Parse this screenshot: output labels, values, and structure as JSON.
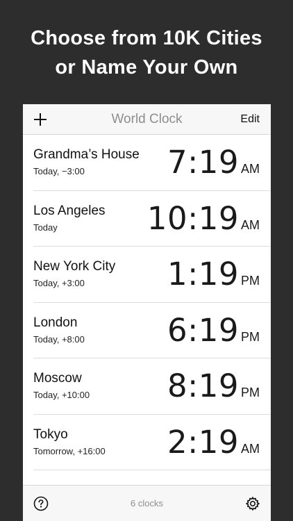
{
  "headline": {
    "line1": "Choose from 10K Cities",
    "line2": "or Name Your Own"
  },
  "navbar": {
    "title": "World Clock",
    "edit_label": "Edit",
    "add_icon": "plus-icon"
  },
  "clocks": [
    {
      "city": "Grandma’s House",
      "offset": "Today, −3:00",
      "time": "7:19",
      "ampm": "AM"
    },
    {
      "city": "Los Angeles",
      "offset": "Today",
      "time": "10:19",
      "ampm": "AM"
    },
    {
      "city": "New York City",
      "offset": "Today, +3:00",
      "time": "1:19",
      "ampm": "PM"
    },
    {
      "city": "London",
      "offset": "Today, +8:00",
      "time": "6:19",
      "ampm": "PM"
    },
    {
      "city": "Moscow",
      "offset": "Today, +10:00",
      "time": "8:19",
      "ampm": "PM"
    },
    {
      "city": "Tokyo",
      "offset": "Tomorrow, +16:00",
      "time": "2:19",
      "ampm": "AM"
    }
  ],
  "toolbar": {
    "count_label": "6 clocks",
    "help_icon": "question-circle-icon",
    "settings_icon": "gear-icon"
  },
  "colors": {
    "background": "#2d2d2d",
    "bar": "#f7f7f7",
    "muted": "#8e8e8e"
  }
}
